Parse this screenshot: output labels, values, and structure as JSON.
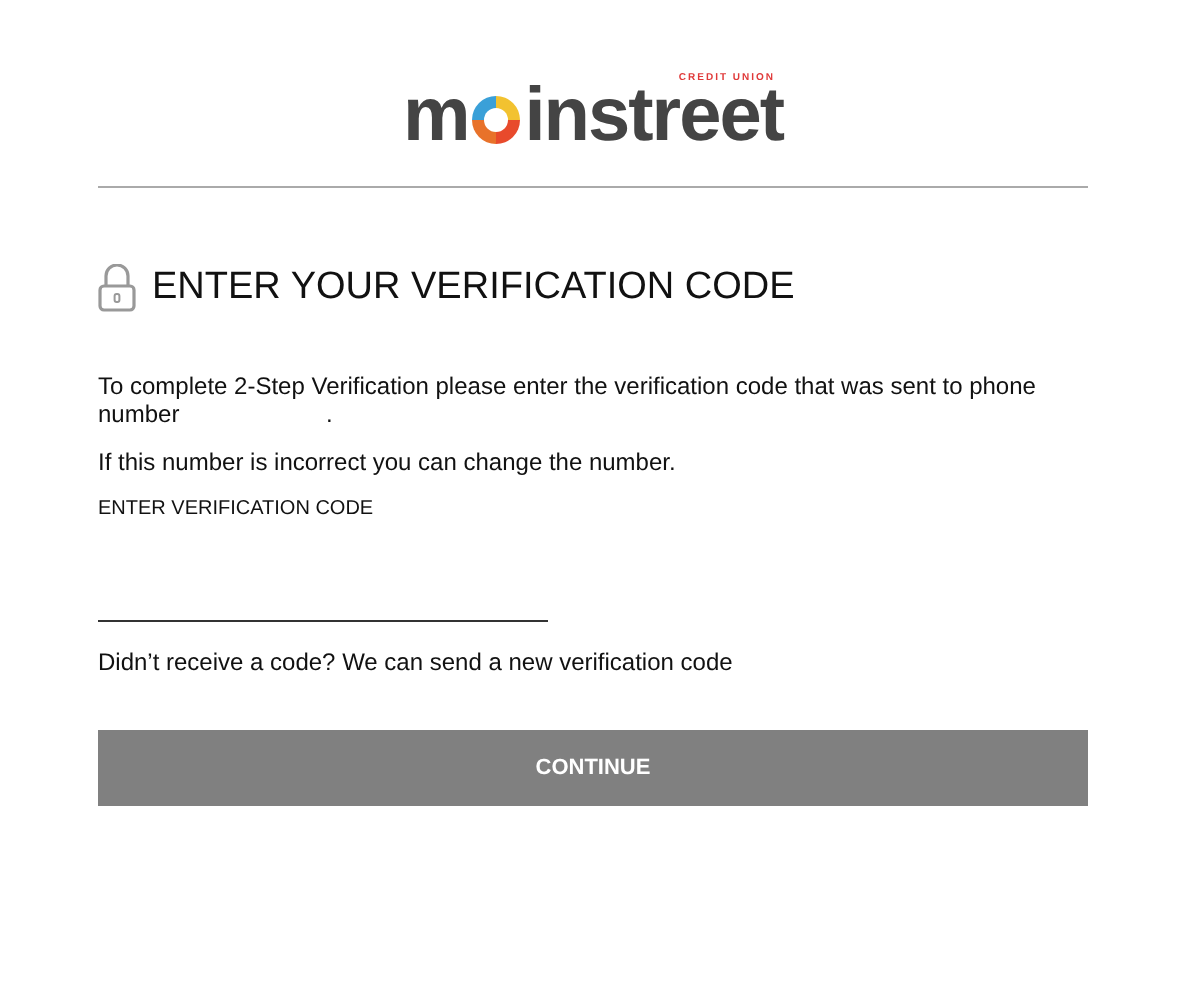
{
  "logo": {
    "start": "m",
    "end": "instreet",
    "tagline": "CREDIT UNION"
  },
  "heading": "ENTER YOUR VERIFICATION CODE",
  "instructions": "To complete 2-Step Verification please enter the verification code that was sent to phone number",
  "instructions_end": ".",
  "change_note": "If this number is incorrect you can change the number.",
  "code_field": {
    "label": "ENTER VERIFICATION CODE"
  },
  "resend_note": "Didn’t receive a code? We can send a new verification code",
  "continue_button": {
    "label": "CONTINUE",
    "disabled": true
  }
}
